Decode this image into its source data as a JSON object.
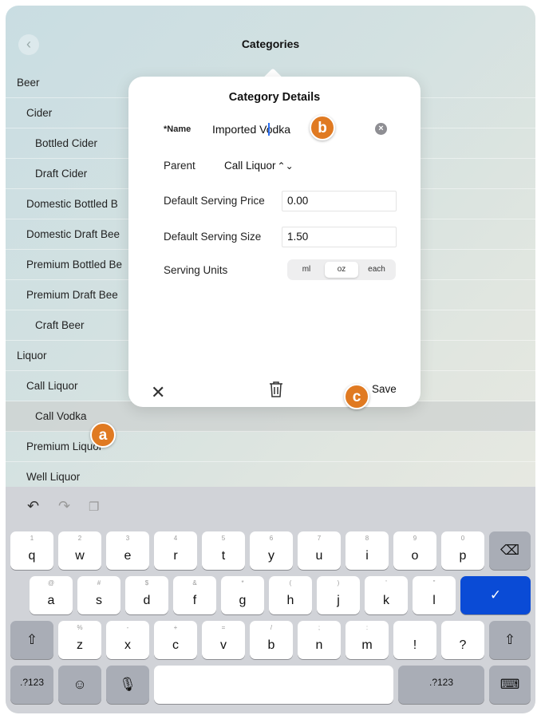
{
  "nav": {
    "title": "Categories",
    "back_icon": "chevron-left-icon"
  },
  "list": {
    "rows": [
      {
        "label": "Beer"
      },
      {
        "label": "Cider"
      },
      {
        "label": "Bottled Cider"
      },
      {
        "label": "Draft Cider"
      },
      {
        "label": "Domestic Bottled B"
      },
      {
        "label": "Domestic Draft Bee"
      },
      {
        "label": "Premium Bottled Be"
      },
      {
        "label": "Premium Draft Bee"
      },
      {
        "label": "Craft Beer"
      },
      {
        "label": "Liquor"
      },
      {
        "label": "Call Liquor"
      },
      {
        "label": "Call Vodka"
      },
      {
        "label": "Premium Liquor"
      },
      {
        "label": "Well Liquor"
      }
    ]
  },
  "popup": {
    "title": "Category Details",
    "name_label": "*Name",
    "name_value": "Imported Vodka",
    "parent_label": "Parent",
    "parent_value": "Call Liquor",
    "price_label": "Default Serving Price",
    "price_value": "0.00",
    "size_label": "Default Serving Size",
    "size_value": "1.50",
    "units_label": "Serving Units",
    "units_options": [
      "ml",
      "oz",
      "each"
    ],
    "units_selected": "oz",
    "save_label": "Save"
  },
  "callouts": [
    "a",
    "b",
    "c"
  ],
  "keyboard": {
    "row1": [
      {
        "k": "q",
        "s": "1"
      },
      {
        "k": "w",
        "s": "2"
      },
      {
        "k": "e",
        "s": "3"
      },
      {
        "k": "r",
        "s": "4"
      },
      {
        "k": "t",
        "s": "5"
      },
      {
        "k": "y",
        "s": "6"
      },
      {
        "k": "u",
        "s": "7"
      },
      {
        "k": "i",
        "s": "8"
      },
      {
        "k": "o",
        "s": "9"
      },
      {
        "k": "p",
        "s": "0"
      }
    ],
    "row2": [
      {
        "k": "a",
        "s": "@"
      },
      {
        "k": "s",
        "s": "#"
      },
      {
        "k": "d",
        "s": "$"
      },
      {
        "k": "f",
        "s": "&"
      },
      {
        "k": "g",
        "s": "*"
      },
      {
        "k": "h",
        "s": "("
      },
      {
        "k": "j",
        "s": ")"
      },
      {
        "k": "k",
        "s": "'"
      },
      {
        "k": "l",
        "s": "\""
      }
    ],
    "row3": [
      {
        "k": "z",
        "s": "%"
      },
      {
        "k": "x",
        "s": "-"
      },
      {
        "k": "c",
        "s": "+"
      },
      {
        "k": "v",
        "s": "="
      },
      {
        "k": "b",
        "s": "/"
      },
      {
        "k": "n",
        "s": ";"
      },
      {
        "k": "m",
        "s": ":"
      },
      {
        "k": "!",
        "s": ""
      },
      {
        "k": "?",
        "s": ""
      }
    ],
    "numbers_label": ".?123",
    "accent_color": "#0a4bd6"
  }
}
